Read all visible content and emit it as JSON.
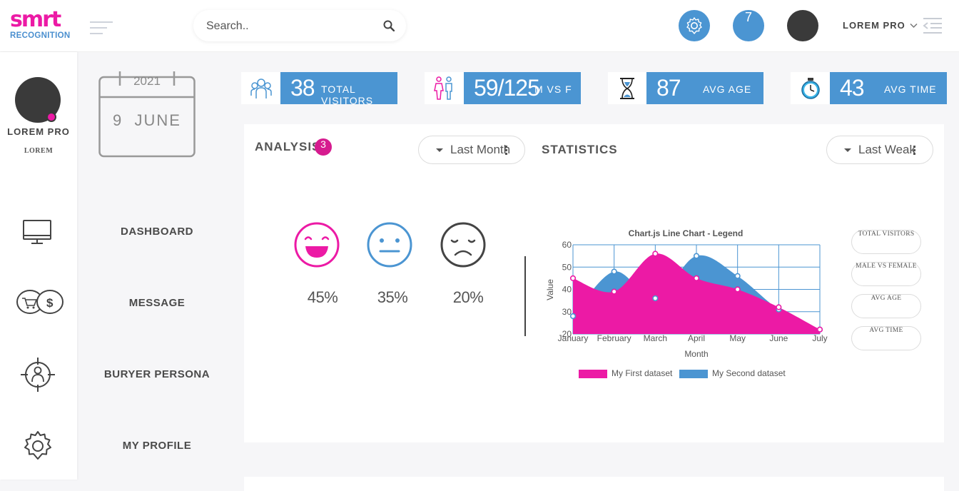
{
  "brand": {
    "logo_top": "smrt",
    "logo_bottom": "RECOGNITION",
    "accent": "#ec1aa5",
    "blue": "#4b95d2"
  },
  "search": {
    "placeholder": "Search..",
    "icon": "search-icon"
  },
  "topbar": {
    "notification_count": "7",
    "user_name": "LOREM PRO",
    "icons": [
      "hamburger-icon",
      "gear-icon",
      "chevron-down-icon",
      "collapse-sidebar-icon"
    ]
  },
  "sidebar": {
    "user_name": "LOREM PRO",
    "user_subtitle": "LOREM",
    "icons": [
      "monitor-icon",
      "chat-shopping-icon",
      "target-person-icon",
      "gear-icon"
    ]
  },
  "date_card": {
    "year": "2021",
    "day": "9",
    "month": "JUNE"
  },
  "menu": [
    {
      "label": "DASHBOARD"
    },
    {
      "label": "MESSAGE"
    },
    {
      "label": "BURYER PERSONA"
    },
    {
      "label": "MY PROFILE"
    }
  ],
  "stats": [
    {
      "value": "38",
      "label": "TOTAL VISITORS",
      "icon": "group-icon"
    },
    {
      "value": "59/125",
      "label": "M VS F",
      "icon": "male-female-icon"
    },
    {
      "value": "87",
      "label": "AVG AGE",
      "icon": "hourglass-icon"
    },
    {
      "value": "43",
      "label": "AVG TIME",
      "icon": "clock-icon"
    }
  ],
  "analysis": {
    "title": "ANALYSIS",
    "badge": "3",
    "dropdown": "Last Month",
    "emotions": [
      {
        "name": "happy",
        "percent": "45%",
        "color": "#ec1aa5",
        "fill": 0.45
      },
      {
        "name": "neutral",
        "percent": "35%",
        "color": "#4b95d2",
        "fill": 0.35
      },
      {
        "name": "sad",
        "percent": "20%",
        "color": "#444444",
        "fill": 0.2
      }
    ]
  },
  "statistics": {
    "title": "STATISTICS",
    "dropdown": "Last Weak",
    "filters": [
      "TOTAL VISITORS",
      "MALE VS FEMALE",
      "AVG AGE",
      "AVG TIME"
    ]
  },
  "chart_data": {
    "type": "area",
    "title": "Chart.js Line Chart - Legend",
    "xlabel": "Month",
    "ylabel": "Value",
    "categories": [
      "January",
      "February",
      "March",
      "April",
      "May",
      "June",
      "July"
    ],
    "ylim": [
      20,
      60
    ],
    "yticks": [
      20,
      30,
      40,
      50,
      60
    ],
    "grid": true,
    "legend_position": "bottom",
    "series": [
      {
        "name": "My First dataset",
        "color": "#ec1aa5",
        "values": [
          45,
          39,
          56,
          45,
          40,
          32,
          22
        ]
      },
      {
        "name": "My Second dataset",
        "color": "#4b95d2",
        "values": [
          28,
          48,
          36,
          55,
          46,
          31,
          22
        ]
      }
    ]
  }
}
